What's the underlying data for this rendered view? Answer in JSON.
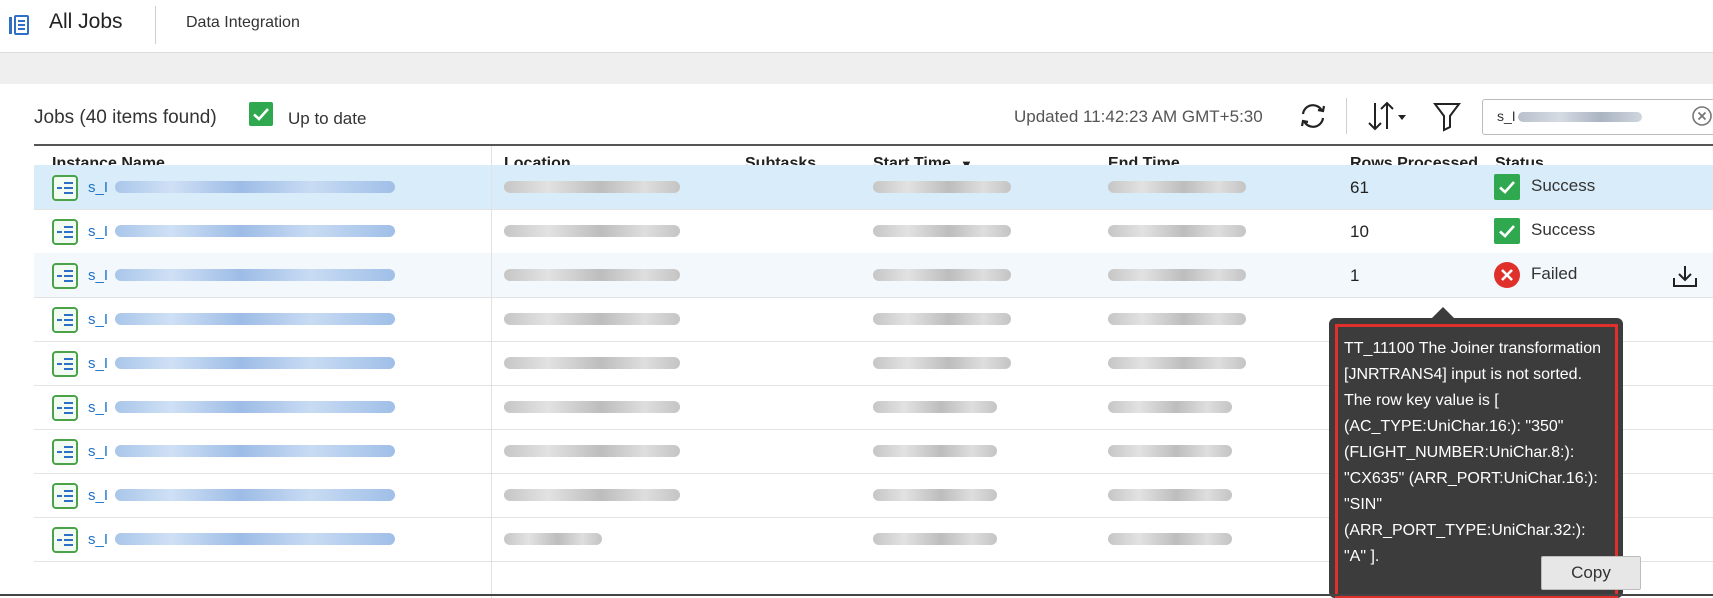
{
  "header": {
    "title": "All Jobs",
    "service": "Data Integration"
  },
  "toolbar": {
    "jobs_count": "Jobs (40 items found)",
    "up_to_date": "Up to date",
    "updated": "Updated 11:42:23 AM GMT+5:30",
    "search_value": "s_I"
  },
  "columns": {
    "instance": "Instance Name",
    "location": "Location",
    "subtasks": "Subtasks",
    "start": "Start Time",
    "end": "End Time",
    "rows": "Rows Processed",
    "status": "Status",
    "sort_indicator": "▼"
  },
  "rows": [
    {
      "prefix": "s_I",
      "rows": "61",
      "status": "Success"
    },
    {
      "prefix": "s_I",
      "rows": "10",
      "status": "Success"
    },
    {
      "prefix": "s_I",
      "rows": "1",
      "status": "Failed"
    },
    {
      "prefix": "s_I",
      "rows": "",
      "status": ""
    },
    {
      "prefix": "s_I",
      "rows": "",
      "status": ""
    },
    {
      "prefix": "s_I",
      "rows": "",
      "status": ""
    },
    {
      "prefix": "s_I",
      "rows": "",
      "status": ""
    },
    {
      "prefix": "s_I",
      "rows": "",
      "status": ""
    },
    {
      "prefix": "s_I",
      "rows": "",
      "status": ""
    }
  ],
  "tooltip": {
    "message": "TT_11100 The Joiner transformation [JNRTRANS4] input is not sorted. The row key value is [ (AC_TYPE:UniChar.16:): \"350\" (FLIGHT_NUMBER:UniChar.8:): \"CX635\" (ARR_PORT:UniChar.16:): \"SIN\" (ARR_PORT_TYPE:UniChar.32:): \"A\" ].",
    "copy_label": "Copy"
  },
  "colors": {
    "success": "#2fa84f",
    "failed": "#e0302b",
    "link": "#1e72c7",
    "selected_row": "#d9ecf9"
  },
  "icons": [
    "jobs-app-icon",
    "checkbox-checked-icon",
    "refresh-icon",
    "sort-icon",
    "filter-icon",
    "clear-icon",
    "task-icon",
    "success-icon",
    "failed-icon",
    "download-icon"
  ]
}
